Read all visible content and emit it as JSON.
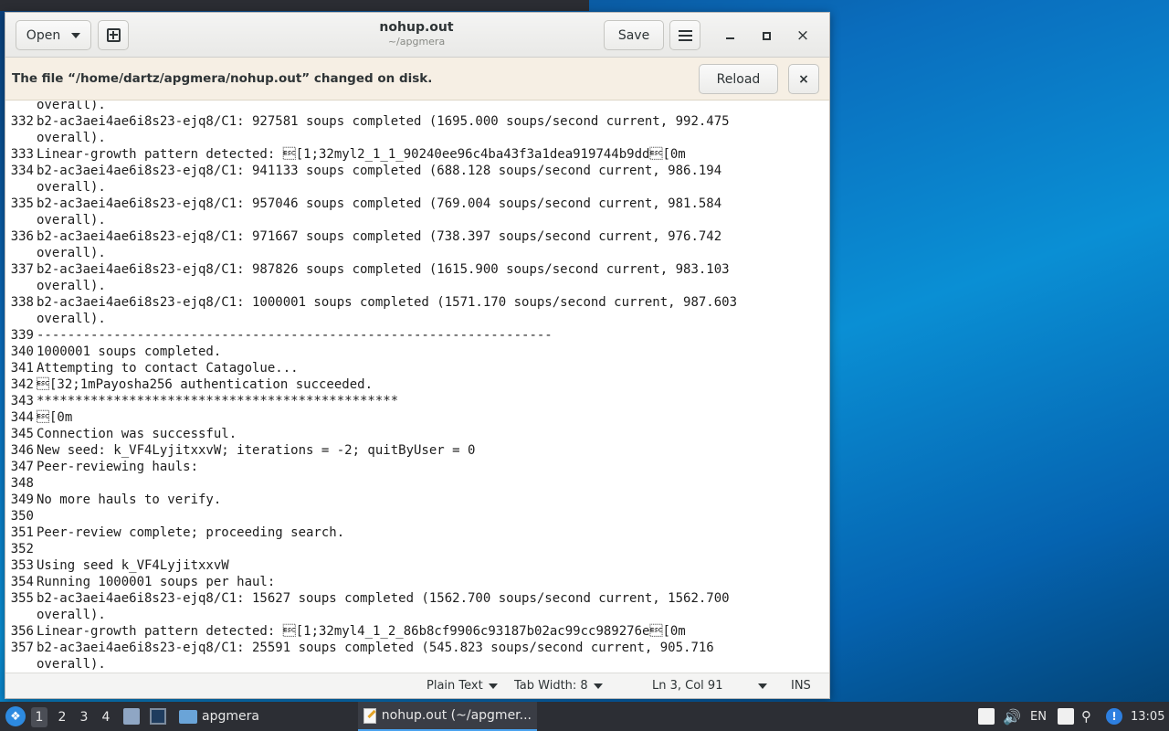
{
  "window": {
    "title": "nohup.out",
    "subtitle": "~/apgmera",
    "open_label": "Open",
    "save_label": "Save",
    "close_glyph": "×"
  },
  "infobar": {
    "message": "The file “/home/dartz/apgmera/nohup.out” changed on disk.",
    "reload_label": "Reload",
    "close_glyph": "×"
  },
  "editor": {
    "lines": [
      {
        "n": "",
        "t": "overall)."
      },
      {
        "n": "332",
        "t": "b2-ac3aei4ae6i8s23-ejq8/C1: 927581 soups completed (1695.000 soups/second current, 992.475"
      },
      {
        "n": "",
        "t": "overall)."
      },
      {
        "n": "333",
        "t": "Linear-growth pattern detected: \u001b[1;32myl2_1_1_90240ee96c4ba43f3a1dea919744b9dd\u001b[0m"
      },
      {
        "n": "334",
        "t": "b2-ac3aei4ae6i8s23-ejq8/C1: 941133 soups completed (688.128 soups/second current, 986.194"
      },
      {
        "n": "",
        "t": "overall)."
      },
      {
        "n": "335",
        "t": "b2-ac3aei4ae6i8s23-ejq8/C1: 957046 soups completed (769.004 soups/second current, 981.584"
      },
      {
        "n": "",
        "t": "overall)."
      },
      {
        "n": "336",
        "t": "b2-ac3aei4ae6i8s23-ejq8/C1: 971667 soups completed (738.397 soups/second current, 976.742"
      },
      {
        "n": "",
        "t": "overall)."
      },
      {
        "n": "337",
        "t": "b2-ac3aei4ae6i8s23-ejq8/C1: 987826 soups completed (1615.900 soups/second current, 983.103"
      },
      {
        "n": "",
        "t": "overall)."
      },
      {
        "n": "338",
        "t": "b2-ac3aei4ae6i8s23-ejq8/C1: 1000001 soups completed (1571.170 soups/second current, 987.603"
      },
      {
        "n": "",
        "t": "overall)."
      },
      {
        "n": "339",
        "t": "-------------------------------------------------------------------"
      },
      {
        "n": "340",
        "t": "1000001 soups completed."
      },
      {
        "n": "341",
        "t": "Attempting to contact Catagolue..."
      },
      {
        "n": "342",
        "t": "\u001b[32;1mPayosha256 authentication succeeded."
      },
      {
        "n": "343",
        "t": "***********************************************"
      },
      {
        "n": "344",
        "t": "\u001b[0m"
      },
      {
        "n": "345",
        "t": "Connection was successful."
      },
      {
        "n": "346",
        "t": "New seed: k_VF4LyjitxxvW; iterations = -2; quitByUser = 0"
      },
      {
        "n": "347",
        "t": "Peer-reviewing hauls:"
      },
      {
        "n": "348",
        "t": ""
      },
      {
        "n": "349",
        "t": "No more hauls to verify."
      },
      {
        "n": "350",
        "t": ""
      },
      {
        "n": "351",
        "t": "Peer-review complete; proceeding search."
      },
      {
        "n": "352",
        "t": ""
      },
      {
        "n": "353",
        "t": "Using seed k_VF4LyjitxxvW"
      },
      {
        "n": "354",
        "t": "Running 1000001 soups per haul:"
      },
      {
        "n": "355",
        "t": "b2-ac3aei4ae6i8s23-ejq8/C1: 15627 soups completed (1562.700 soups/second current, 1562.700"
      },
      {
        "n": "",
        "t": "overall)."
      },
      {
        "n": "356",
        "t": "Linear-growth pattern detected: \u001b[1;32myl4_1_2_86b8cf9906c93187b02ac99cc989276e\u001b[0m"
      },
      {
        "n": "357",
        "t": "b2-ac3aei4ae6i8s23-ejq8/C1: 25591 soups completed (545.823 soups/second current, 905.716"
      },
      {
        "n": "",
        "t": "overall)."
      }
    ]
  },
  "statusbar": {
    "language": "Plain Text",
    "tab_width": "Tab Width: 8",
    "position": "Ln 3, Col 91",
    "mode": "INS"
  },
  "taskbar": {
    "workspaces": [
      "1",
      "2",
      "3",
      "4"
    ],
    "active_workspace": "1",
    "tasks": [
      {
        "label": "apgmera",
        "icon": "folder-icon"
      },
      {
        "label": "nohup.out (~/apgmer...",
        "icon": "text-editor-icon"
      }
    ],
    "keyboard_layout": "EN",
    "clock": "13:05"
  },
  "colors": {
    "accent": "#4aa3f0",
    "infobar_bg": "#f6efe4",
    "taskbar_bg": "#2c2e34"
  }
}
